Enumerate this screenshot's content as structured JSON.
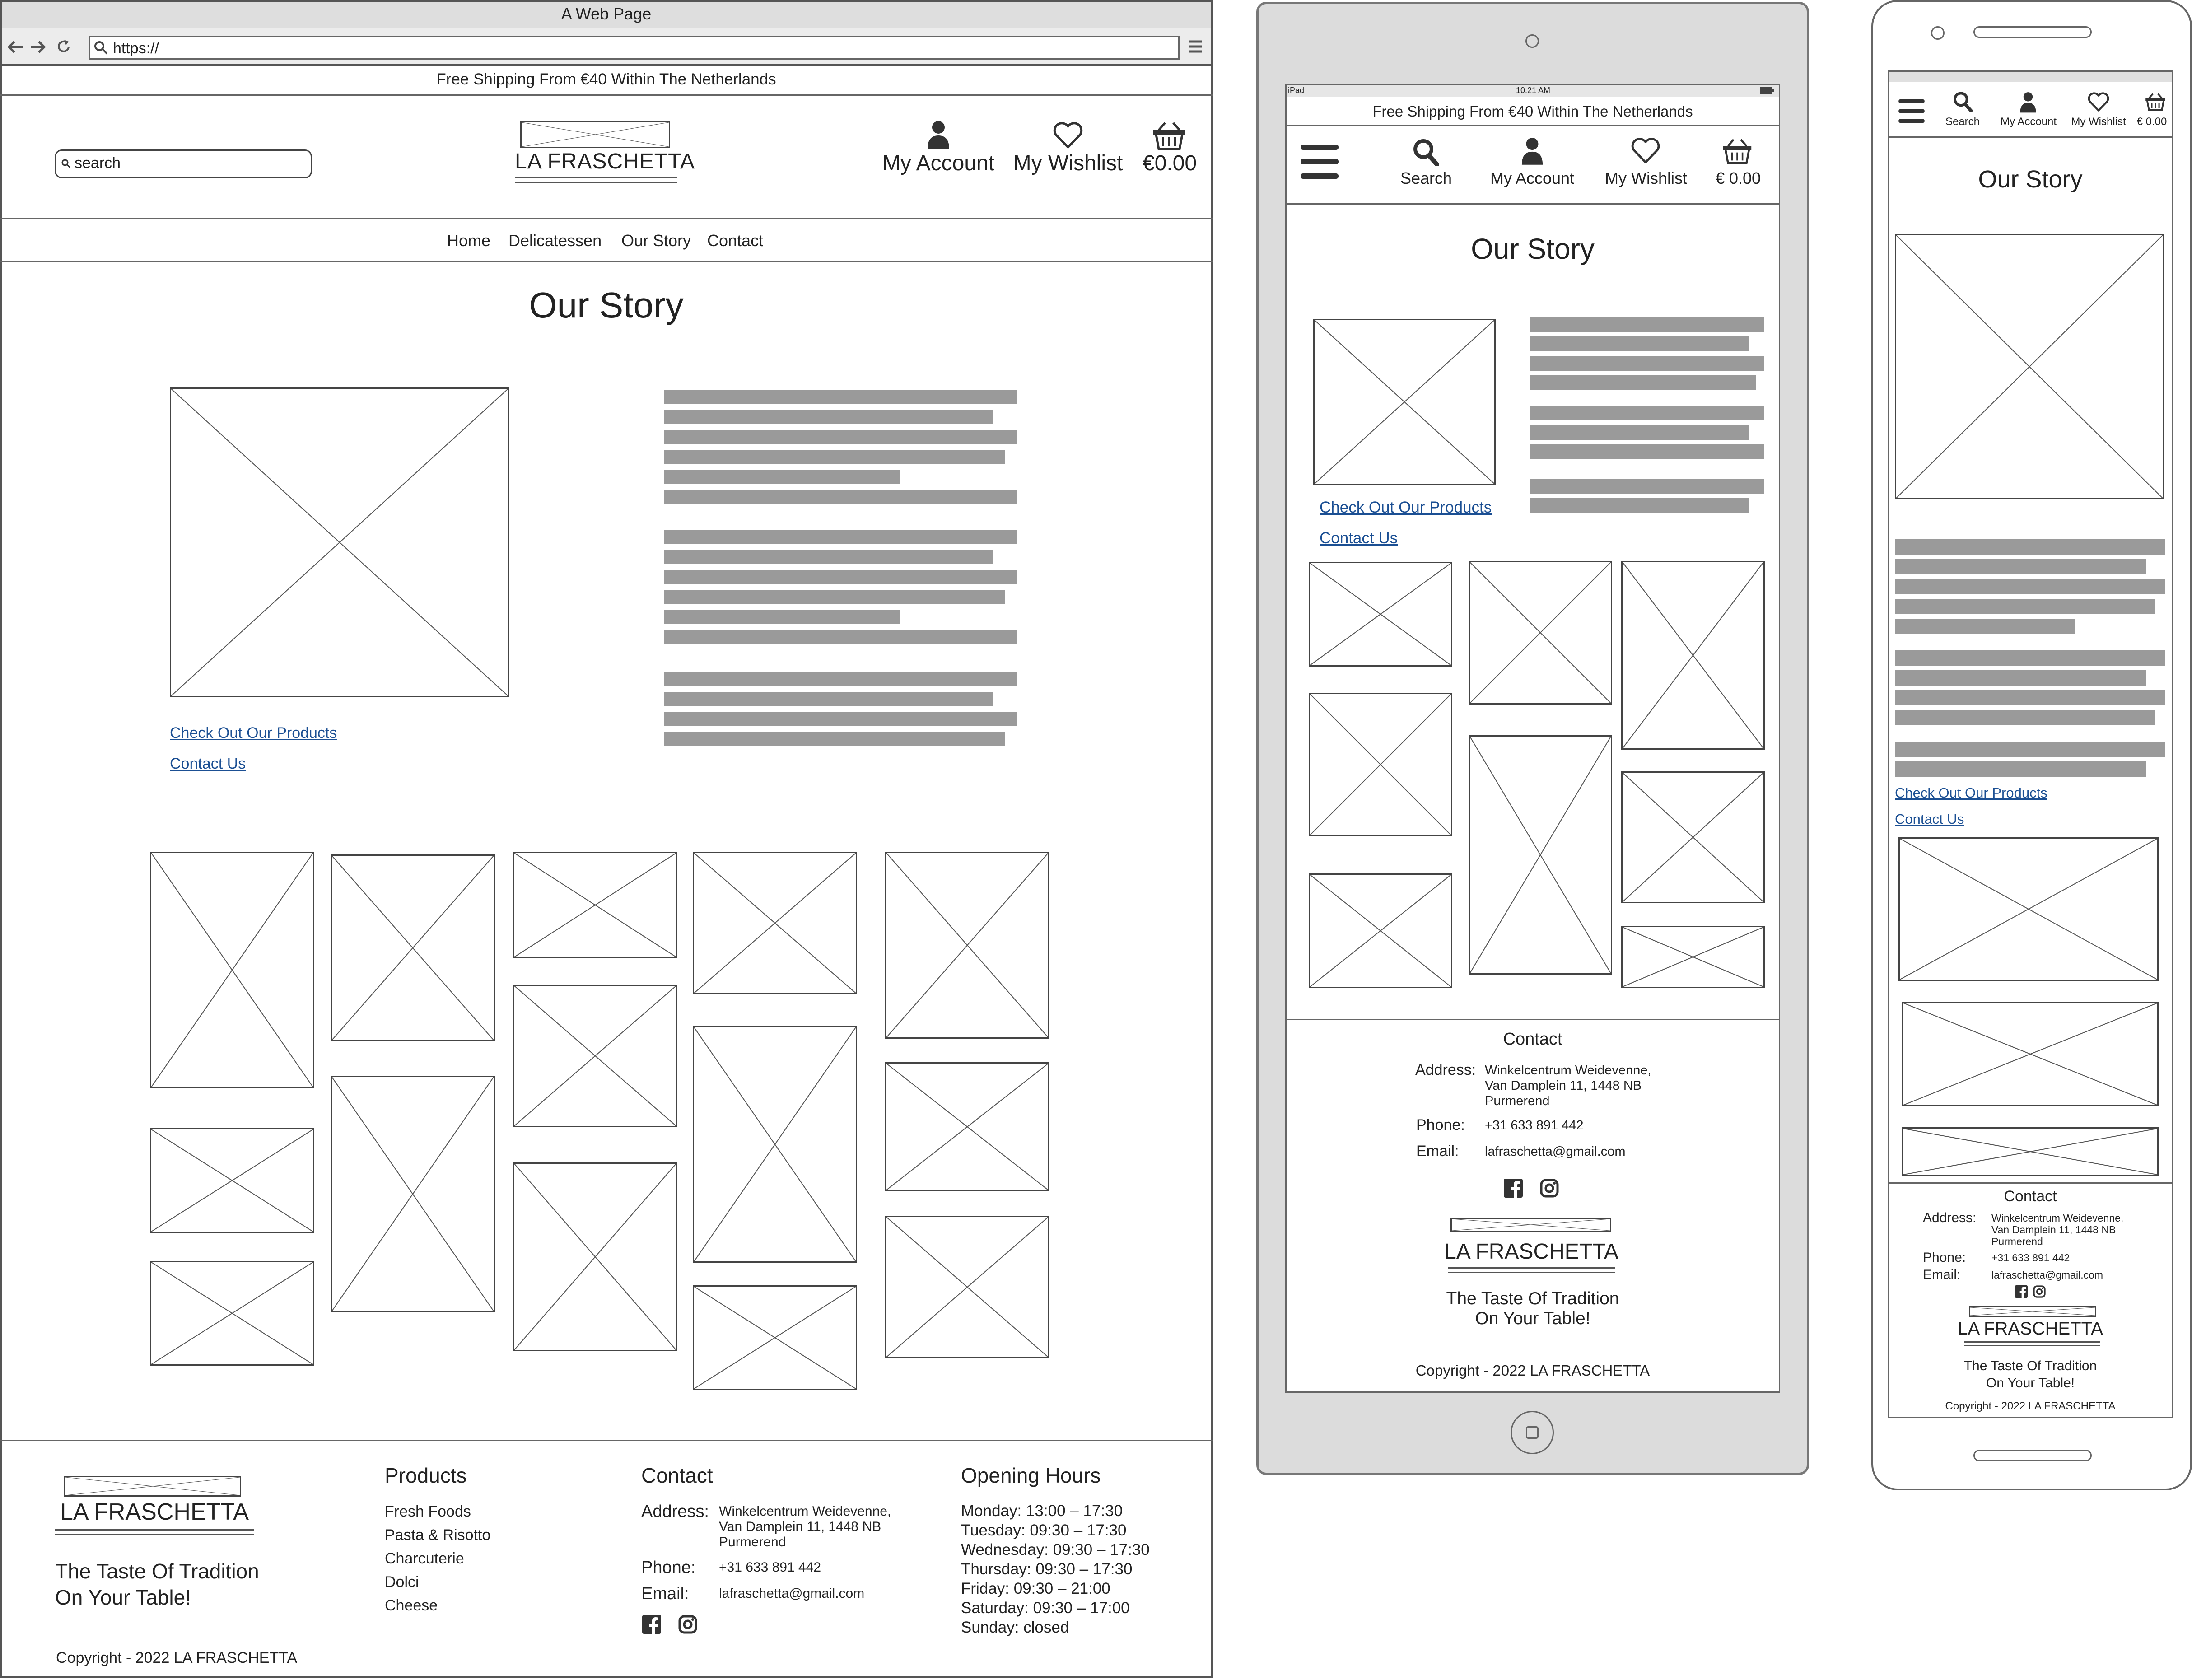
{
  "browser": {
    "title": "A Web Page",
    "url": "https://"
  },
  "banner": {
    "text": "Free Shipping From €40 Within The Netherlands"
  },
  "header": {
    "search_placeholder": "search",
    "logo": "LA FRASCHETTA",
    "account": "My Account",
    "wishlist": "My Wishlist",
    "cart": "€0.00"
  },
  "nav": {
    "items": [
      "Home",
      "Delicatessen",
      "Our Story",
      "Contact"
    ]
  },
  "main": {
    "title": "Our Story",
    "links": {
      "products": "Check Out Our Products",
      "contact": "Contact Us"
    }
  },
  "footer": {
    "logo": "LA FRASCHETTA",
    "tagline": [
      "The Taste Of Tradition",
      "On Your Table!"
    ],
    "copyright": "Copyright - 2022 LA FRASCHETTA",
    "products": {
      "heading": "Products",
      "items": [
        "Fresh Foods",
        "Pasta & Risotto",
        "Charcuterie",
        "Dolci",
        "Cheese"
      ]
    },
    "contact": {
      "heading": "Contact",
      "address_label": "Address:",
      "address_lines": [
        "Winkelcentrum Weidevenne,",
        "Van Damplein 11, 1448 NB",
        "Purmerend"
      ],
      "phone_label": "Phone:",
      "phone": "+31 633 891 442",
      "email_label": "Email:",
      "email": "lafraschetta@gmail.com"
    },
    "hours": {
      "heading": "Opening Hours",
      "lines": [
        "Monday: 13:00 – 17:30",
        "Tuesday: 09:30 – 17:30",
        "Wednesday: 09:30 – 17:30",
        "Thursday: 09:30 – 17:30",
        "Friday: 09:30 – 21:00",
        "Saturday: 09:30 – 17:00",
        "Sunday: closed"
      ]
    }
  },
  "tablet": {
    "status_left": "iPad",
    "status_time": "10:21 AM",
    "banner": "Free Shipping From €40 Within The Netherlands",
    "search": "Search",
    "account": "My Account",
    "wishlist": "My Wishlist",
    "cart": "€ 0.00",
    "title": "Our Story",
    "link_products": "Check Out Our Products",
    "link_contact": "Contact Us",
    "footer_heading": "Contact",
    "address_label": "Address:",
    "address_lines": [
      "Winkelcentrum Weidevenne,",
      "Van Damplein 11, 1448 NB",
      "Purmerend"
    ],
    "phone_label": "Phone:",
    "phone": "+31 633 891 442",
    "email_label": "Email:",
    "email": "lafraschetta@gmail.com",
    "logo": "LA FRASCHETTA",
    "tagline": [
      "The Taste Of Tradition",
      "On Your Table!"
    ],
    "copyright": "Copyright - 2022 LA FRASCHETTA"
  },
  "phone": {
    "search": "Search",
    "account": "My Account",
    "wishlist": "My Wishlist",
    "cart": "€ 0.00",
    "title": "Our Story",
    "link_products": "Check Out Our Products",
    "link_contact": "Contact Us",
    "footer_heading": "Contact",
    "address_label": "Address:",
    "address_lines": [
      "Winkelcentrum Weidevenne,",
      "Van Damplein 11, 1448 NB",
      "Purmerend"
    ],
    "phone_label": "Phone:",
    "phone": "+31 633 891 442",
    "email_label": "Email:",
    "email": "lafraschetta@gmail.com",
    "logo": "LA FRASCHETTA",
    "tagline": [
      "The Taste Of Tradition",
      "On Your Table!"
    ],
    "copyright": "Copyright - 2022 LA FRASCHETTA"
  }
}
